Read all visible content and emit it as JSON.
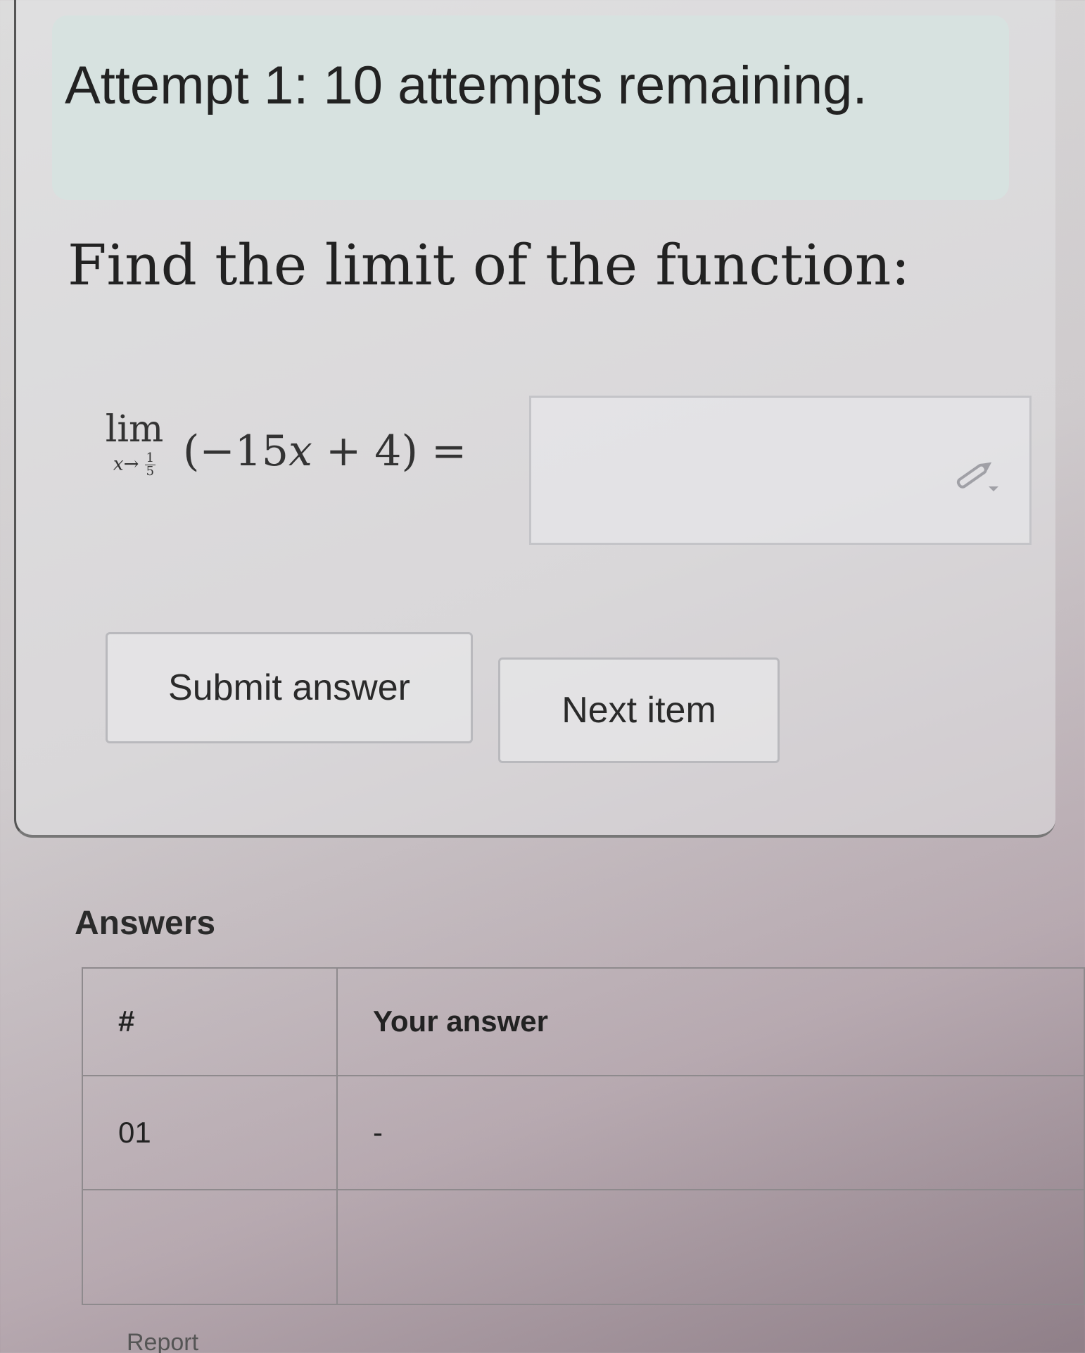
{
  "banner": {
    "attempt_text": "Attempt 1: 10 attempts remaining."
  },
  "question": {
    "prompt": "Find the limit of the function:",
    "lim_word": "lim",
    "lim_var": "x",
    "lim_arrow": "→",
    "lim_num": "1",
    "lim_den": "5",
    "expr_open": "(−15",
    "expr_var": "x",
    "expr_close": " + 4) ="
  },
  "answer_input": {
    "value": "",
    "icon": "pencil-icon"
  },
  "buttons": {
    "submit_label": "Submit answer",
    "next_label": "Next item"
  },
  "answers": {
    "heading": "Answers",
    "columns": [
      "#",
      "Your answer"
    ],
    "rows": [
      [
        "01",
        "-"
      ],
      [
        "",
        ""
      ]
    ]
  },
  "footer": {
    "report_text": "Report"
  }
}
